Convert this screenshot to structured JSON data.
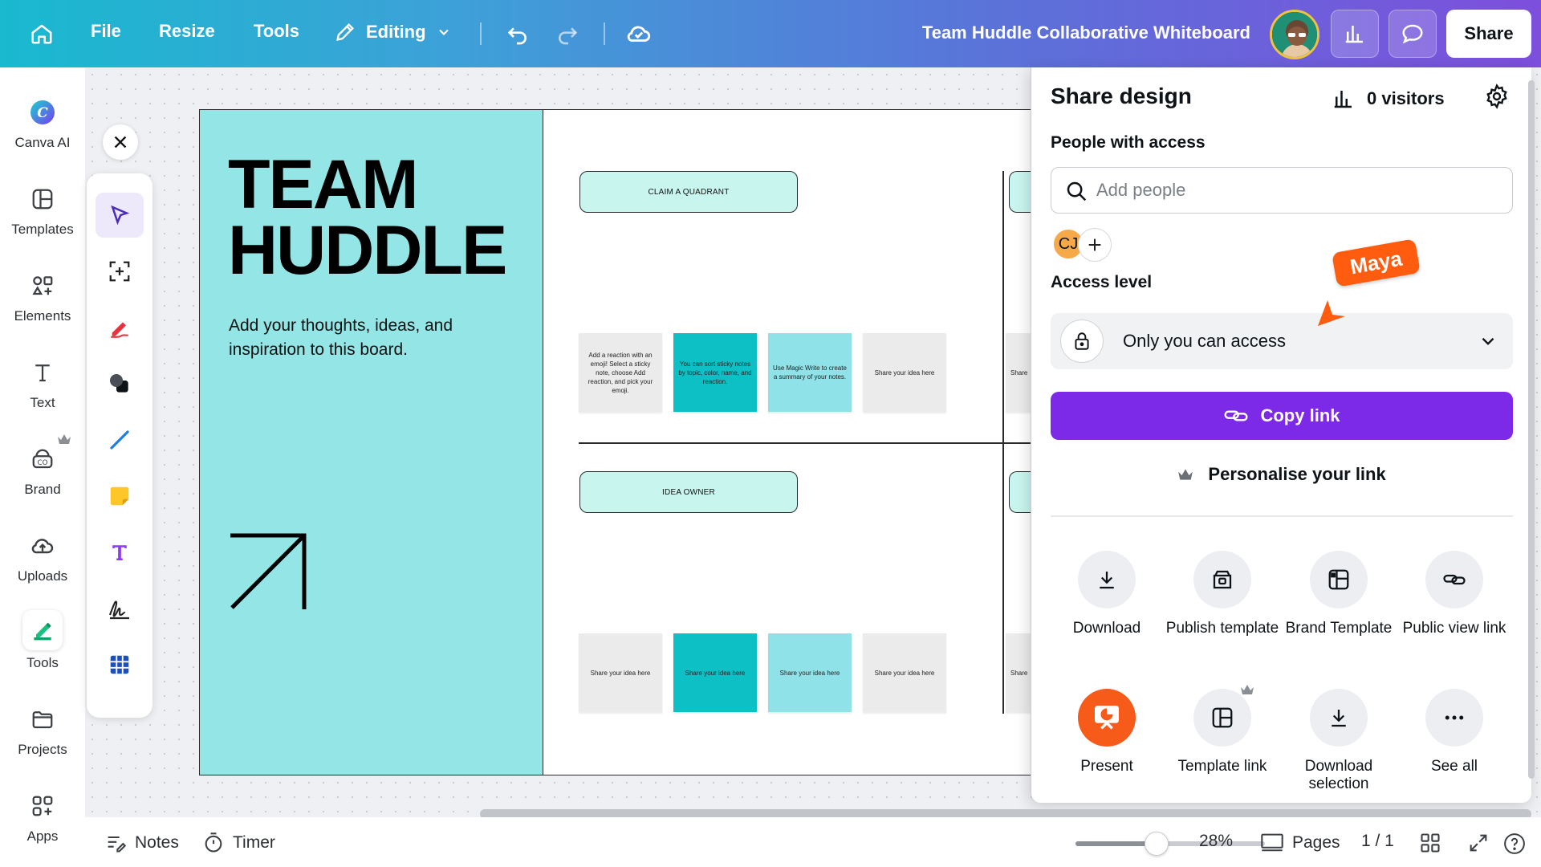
{
  "topbar": {
    "file": "File",
    "resize": "Resize",
    "tools": "Tools",
    "editing": "Editing",
    "doc_title": "Team Huddle Collaborative Whiteboard",
    "share": "Share"
  },
  "rail": {
    "items": [
      {
        "label": "Canva AI",
        "icon": "canva-ai-icon"
      },
      {
        "label": "Templates",
        "icon": "templates-icon"
      },
      {
        "label": "Elements",
        "icon": "elements-icon"
      },
      {
        "label": "Text",
        "icon": "text-icon"
      },
      {
        "label": "Brand",
        "icon": "brand-icon"
      },
      {
        "label": "Uploads",
        "icon": "uploads-icon"
      },
      {
        "label": "Tools",
        "icon": "tools-icon"
      },
      {
        "label": "Projects",
        "icon": "projects-icon"
      },
      {
        "label": "Apps",
        "icon": "apps-icon"
      }
    ]
  },
  "board": {
    "title_line1": "TEAM",
    "title_line2": "HUDDLE",
    "subtitle": "Add your thoughts, ideas, and inspiration to this board.",
    "pill_top": "CLAIM A QUADRANT",
    "pill_bottom": "IDEA OWNER",
    "notes_top": [
      {
        "text": "Add a reaction with an emoji! Select a sticky note, choose Add reaction, and pick your emoji.",
        "color": "grey"
      },
      {
        "text": "You can sort sticky notes by topic, color, name, and reaction.",
        "color": "teal"
      },
      {
        "text": "Use Magic Write to create a summary of your notes.",
        "color": "lite"
      },
      {
        "text": "Share your idea here",
        "color": "grey"
      }
    ],
    "notes_bottom": [
      {
        "text": "Share your idea here",
        "color": "grey"
      },
      {
        "text": "Share your idea here",
        "color": "teal"
      },
      {
        "text": "Share your idea here",
        "color": "lite"
      },
      {
        "text": "Share your idea here",
        "color": "grey"
      }
    ],
    "partial_note": "Share"
  },
  "panel": {
    "title": "Share design",
    "visitors": "0 visitors",
    "people_label": "People with access",
    "add_placeholder": "Add people",
    "initials": "CJ",
    "access_label": "Access level",
    "access_value": "Only you can access",
    "copy_link": "Copy link",
    "personalise": "Personalise your link",
    "options": [
      {
        "label": "Download",
        "icon": "download-icon"
      },
      {
        "label": "Publish template",
        "icon": "publish-template-icon"
      },
      {
        "label": "Brand Template",
        "icon": "brand-template-icon"
      },
      {
        "label": "Public view link",
        "icon": "public-link-icon"
      },
      {
        "label": "Present",
        "icon": "present-icon"
      },
      {
        "label": "Template link",
        "icon": "template-link-icon"
      },
      {
        "label": "Download selection",
        "icon": "download-selection-icon"
      },
      {
        "label": "See all",
        "icon": "more-icon"
      }
    ]
  },
  "cursor_label": "Maya",
  "bottom": {
    "notes": "Notes",
    "timer": "Timer",
    "zoom": "28%",
    "zoom_level": 0.28,
    "pages": "Pages",
    "page_count": "1 / 1"
  },
  "colors": {
    "accent_purple": "#7d2ae8",
    "board_teal": "#94e5e5",
    "cursor_orange": "#ff5c10",
    "present_orange": "#f65b1a"
  }
}
